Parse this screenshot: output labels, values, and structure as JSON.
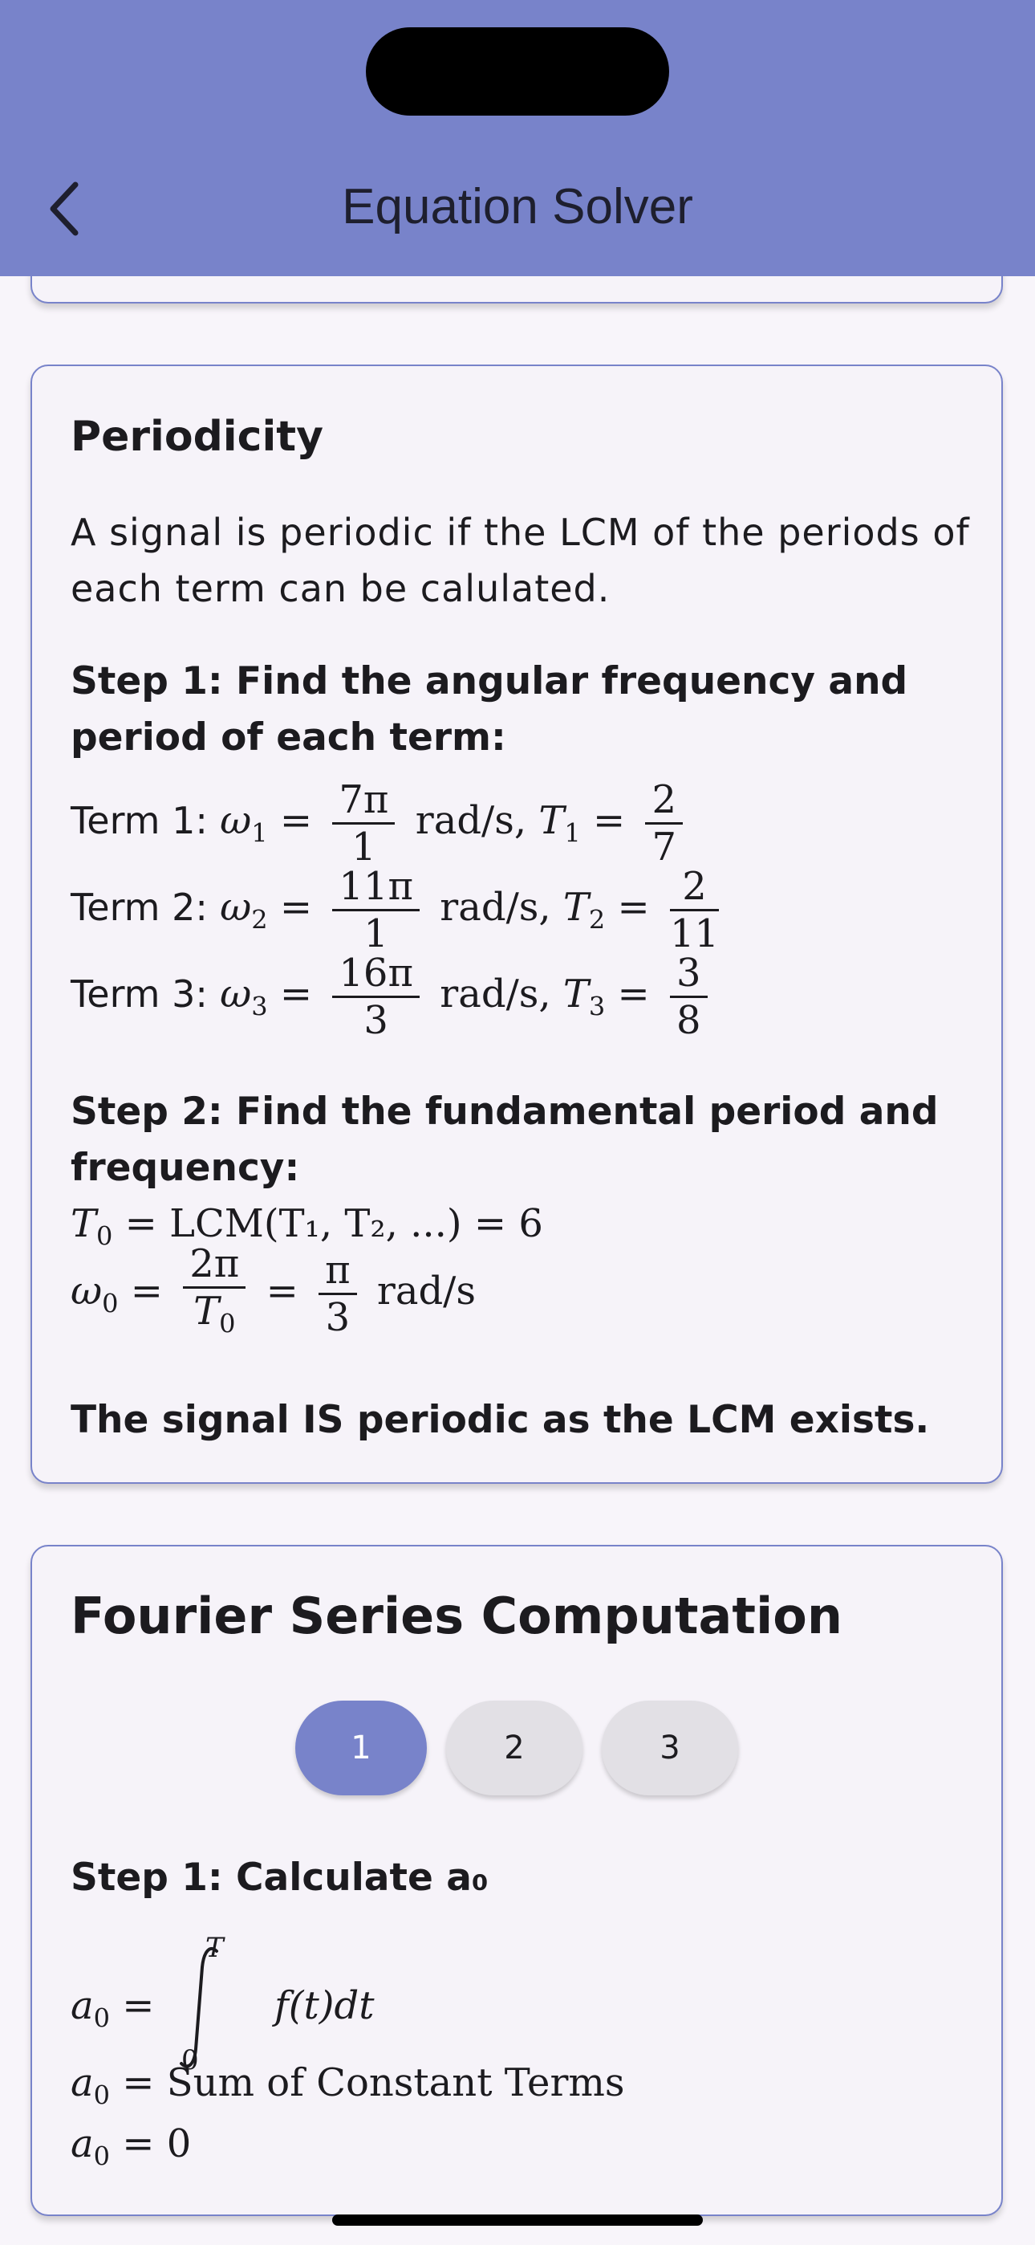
{
  "app_bar": {
    "title": "Equation Solver"
  },
  "periodicity": {
    "heading": "Periodicity",
    "intro": "A signal is periodic if the LCM of the periods of each term can be calulated.",
    "step1_title": "Step 1: Find the angular frequency and period of each term:",
    "terms": [
      {
        "label": "Term 1:",
        "omega_sym": "ω",
        "sub": "1",
        "num": "7π",
        "den": "1",
        "unit": "rad/s,",
        "T_num": "2",
        "T_den": "7"
      },
      {
        "label": "Term 2:",
        "omega_sym": "ω",
        "sub": "2",
        "num": "11π",
        "den": "1",
        "unit": "rad/s,",
        "T_num": "2",
        "T_den": "11"
      },
      {
        "label": "Term 3:",
        "omega_sym": "ω",
        "sub": "3",
        "num": "16π",
        "den": "3",
        "unit": "rad/s,",
        "T_num": "3",
        "T_den": "8"
      }
    ],
    "step2_title": "Step 2: Find the fundamental period and frequency:",
    "t0_equation": "= LCM(T₁, T₂, ...) = 6",
    "w0_num": "2π",
    "w0_den_sym": "T",
    "w0_den_sub": "0",
    "w0_num2": "π",
    "w0_den2": "3",
    "w0_unit": "rad/s",
    "conclusion": "The signal IS periodic as the LCM exists."
  },
  "fourier": {
    "heading": "Fourier Series Computation",
    "step_buttons": [
      "1",
      "2",
      "3"
    ],
    "active_step": "1",
    "step_title": "Step 1: Calculate a₀",
    "integral_upper": "T",
    "integral_lower": "0",
    "integrand": "f(t)dt",
    "line2_rhs": "= Sum of Constant Terms",
    "line3_rhs": "= 0"
  }
}
